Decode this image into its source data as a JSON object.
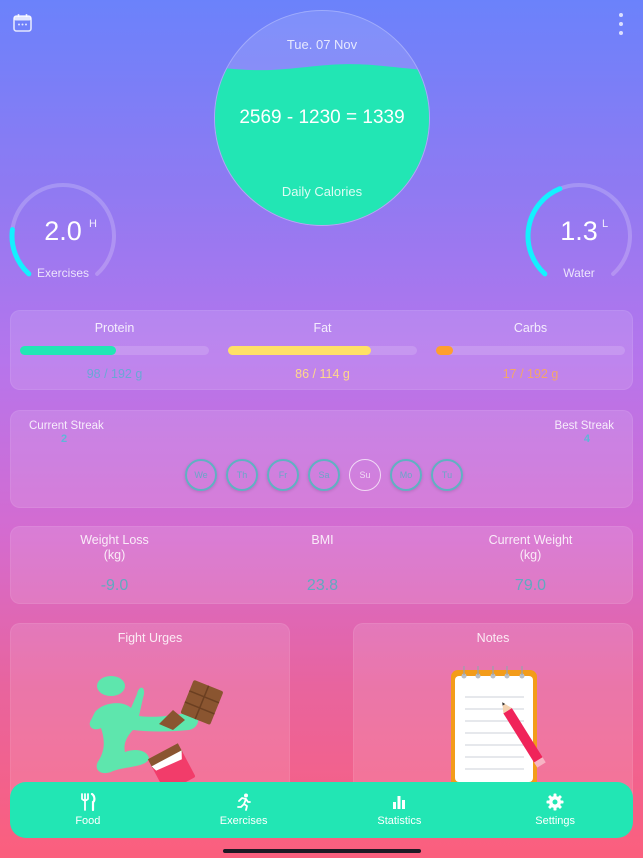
{
  "header": {
    "calendar_icon": "calendar-icon",
    "more_icon": "more-vertical-icon"
  },
  "calories": {
    "date": "Tue. 07 Nov",
    "goal": 2569,
    "consumed": 1230,
    "remaining": 1339,
    "equation": "2569 - 1230 = 1339",
    "label": "Daily Calories",
    "fill_fraction": 0.74,
    "fill_color": "#22e6b4"
  },
  "exercises_gauge": {
    "value": "2.0",
    "unit": "H",
    "label": "Exercises",
    "progress_fraction": 0.2,
    "color": "#14f1ff"
  },
  "water_gauge": {
    "value": "1.3",
    "unit": "L",
    "label": "Water",
    "progress_fraction": 0.42,
    "color": "#14f1ff"
  },
  "macros": [
    {
      "label": "Protein",
      "value_text": "98 / 192 g",
      "consumed": 98,
      "goal": 192,
      "color": "#22e6b4",
      "text_color": "#6aa7d6"
    },
    {
      "label": "Fat",
      "value_text": "86 / 114 g",
      "consumed": 86,
      "goal": 114,
      "color": "#ffe066",
      "text_color": "#ffd88a"
    },
    {
      "label": "Carbs",
      "value_text": "17 / 192 g",
      "consumed": 17,
      "goal": 192,
      "color": "#ff9f2e",
      "text_color": "#f2a66a"
    }
  ],
  "streak": {
    "current_label": "Current Streak",
    "current_value": "2",
    "best_label": "Best Streak",
    "best_value": "4",
    "days": [
      {
        "label": "We",
        "done": true
      },
      {
        "label": "Th",
        "done": true
      },
      {
        "label": "Fr",
        "done": true
      },
      {
        "label": "Sa",
        "done": true
      },
      {
        "label": "Su",
        "done": false
      },
      {
        "label": "Mo",
        "done": true
      },
      {
        "label": "Tu",
        "done": true
      }
    ]
  },
  "stats": [
    {
      "label": "Weight Loss\n(kg)",
      "value": "-9.0"
    },
    {
      "label": "BMI",
      "value": "23.8"
    },
    {
      "label": "Current Weight\n(kg)",
      "value": "79.0"
    }
  ],
  "tiles": {
    "fight_urges": {
      "title": "Fight Urges",
      "icon": "kick-chocolate-illustration"
    },
    "notes": {
      "title": "Notes",
      "icon": "notepad-pencil-illustration"
    }
  },
  "tabbar": [
    {
      "label": "Food",
      "icon": "fork-knife-icon"
    },
    {
      "label": "Exercises",
      "icon": "running-person-icon"
    },
    {
      "label": "Statistics",
      "icon": "bar-chart-icon"
    },
    {
      "label": "Settings",
      "icon": "gear-icon"
    }
  ]
}
